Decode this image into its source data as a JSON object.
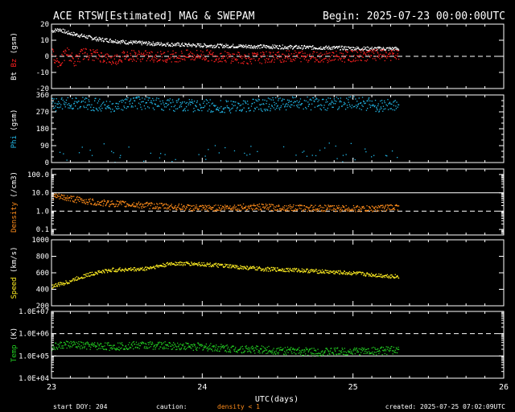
{
  "title": "ACE RTSW[Estimated] MAG & SWEPAM",
  "begin": "Begin: 2025-07-23 00:00:00UTC",
  "xlabel": "UTC(days)",
  "footer": {
    "start": "start DOY: 204",
    "caution": "caution:",
    "density_note": "density < 1",
    "created": "created: 2025-07-25 07:02:09UTC"
  },
  "colors": {
    "bt": "#ffffff",
    "bz": "#ff2020",
    "phi": "#22b8e8",
    "density": "#ff8c1a",
    "speed": "#ffee22",
    "temp": "#22cc22",
    "axes": "#ffffff"
  },
  "chart_data": [
    {
      "type": "scatter",
      "id": "mag",
      "ylabel_parts": [
        {
          "text": "Bt",
          "color": "#ffffff"
        },
        {
          "text": " ",
          "color": "#ffffff"
        },
        {
          "text": "Bz",
          "color": "#ff2020"
        },
        {
          "text": " (gsm)",
          "color": "#ffffff"
        }
      ],
      "ylim": [
        -20,
        20
      ],
      "yticks": [
        -20,
        -10,
        0,
        10,
        20
      ],
      "ylabels": [
        "-20",
        "-10",
        "0",
        "10",
        "20"
      ],
      "ref_lines": [
        {
          "y": 0,
          "style": "dash"
        }
      ],
      "xlim": [
        23,
        26
      ],
      "series": [
        {
          "name": "Bt",
          "color": "#ffffff",
          "x": [
            23.0,
            23.05,
            23.1,
            23.15,
            23.2,
            23.3,
            23.4,
            23.5,
            23.7,
            24.0,
            24.3,
            24.6,
            24.9,
            25.1,
            25.3
          ],
          "y": [
            16,
            17,
            15,
            14,
            13,
            11,
            10,
            9,
            8,
            7,
            6.5,
            6,
            5.5,
            5,
            5
          ]
        },
        {
          "name": "Bz",
          "color": "#ff2020",
          "x": [
            23.0,
            23.05,
            23.1,
            23.15,
            23.2,
            23.3,
            23.4,
            23.5,
            23.7,
            24.0,
            24.3,
            24.6,
            24.9,
            25.1,
            25.3
          ],
          "y": [
            2,
            -4,
            3,
            -3,
            2,
            1,
            -2,
            1,
            0,
            1,
            -1,
            0.5,
            0,
            1,
            1
          ]
        }
      ]
    },
    {
      "type": "scatter",
      "id": "phi",
      "ylabel_parts": [
        {
          "text": "Phi",
          "color": "#22b8e8"
        },
        {
          "text": " (gsm)",
          "color": "#ffffff"
        }
      ],
      "ylim": [
        0,
        360
      ],
      "yticks": [
        0,
        90,
        180,
        270,
        360
      ],
      "ylabels": [
        "0",
        "90",
        "180",
        "270",
        "360"
      ],
      "minor": [
        30,
        60,
        120,
        150,
        210,
        240,
        300,
        330
      ],
      "ref_lines": [],
      "xlim": [
        23,
        26
      ],
      "series": [
        {
          "name": "Phi",
          "color": "#22b8e8",
          "x": [
            23.0,
            23.2,
            23.4,
            23.5,
            23.6,
            23.8,
            24.0,
            24.2,
            24.4,
            24.6,
            24.8,
            25.0,
            25.2,
            25.3
          ],
          "y": [
            310,
            320,
            300,
            315,
            320,
            310,
            305,
            300,
            310,
            320,
            315,
            320,
            305,
            315
          ]
        }
      ]
    },
    {
      "type": "scatter",
      "id": "density",
      "ylabel_parts": [
        {
          "text": "Density",
          "color": "#ff8c1a"
        },
        {
          "text": " (/cm3)",
          "color": "#ffffff"
        }
      ],
      "ylim": [
        0.05,
        200
      ],
      "scale": "log",
      "yticks": [
        0.1,
        1.0,
        10.0,
        100.0
      ],
      "ylabels": [
        "0.1",
        "1.0",
        "10.0",
        "100.0"
      ],
      "ref_lines": [
        {
          "y": 10,
          "style": "solid"
        },
        {
          "y": 1,
          "style": "dash"
        }
      ],
      "xlim": [
        23,
        26
      ],
      "series": [
        {
          "name": "Density",
          "color": "#ff8c1a",
          "x": [
            23.0,
            23.1,
            23.2,
            23.3,
            23.5,
            23.7,
            24.0,
            24.3,
            24.6,
            24.9,
            25.1,
            25.3
          ],
          "y": [
            7,
            5.5,
            4,
            3,
            2.5,
            2,
            1.5,
            1.8,
            1.6,
            1.5,
            1.4,
            1.8
          ]
        }
      ]
    },
    {
      "type": "scatter",
      "id": "speed",
      "ylabel_parts": [
        {
          "text": "Speed",
          "color": "#ffee22"
        },
        {
          "text": " (km/s)",
          "color": "#ffffff"
        }
      ],
      "ylim": [
        200,
        1000
      ],
      "yticks": [
        200,
        400,
        600,
        800,
        1000
      ],
      "ylabels": [
        "200",
        "400",
        "600",
        "800",
        "1000"
      ],
      "ref_lines": [],
      "xlim": [
        23,
        26
      ],
      "series": [
        {
          "name": "Speed",
          "color": "#ffee22",
          "x": [
            23.0,
            23.1,
            23.2,
            23.3,
            23.4,
            23.6,
            23.75,
            23.8,
            24.0,
            24.2,
            24.4,
            24.6,
            24.8,
            25.0,
            25.2,
            25.3
          ],
          "y": [
            440,
            490,
            560,
            610,
            640,
            650,
            700,
            720,
            710,
            680,
            650,
            640,
            620,
            600,
            570,
            560
          ]
        }
      ]
    },
    {
      "type": "scatter",
      "id": "temp",
      "ylabel_parts": [
        {
          "text": "Temp",
          "color": "#22cc22"
        },
        {
          "text": " (K)",
          "color": "#ffffff"
        }
      ],
      "ylim": [
        10000,
        10000000
      ],
      "scale": "log",
      "yticks": [
        10000,
        100000,
        1000000,
        10000000
      ],
      "ylabels": [
        "1.0E+04",
        "1.0E+05",
        "1.0E+06",
        "1.0E+07"
      ],
      "ref_lines": [
        {
          "y": 1000000,
          "style": "dash"
        },
        {
          "y": 100000,
          "style": "solid"
        }
      ],
      "xlim": [
        23,
        26
      ],
      "series": [
        {
          "name": "Temp",
          "color": "#22cc22",
          "x": [
            23.0,
            23.1,
            23.2,
            23.4,
            23.6,
            23.8,
            24.0,
            24.2,
            24.4,
            24.6,
            24.8,
            25.0,
            25.2,
            25.3
          ],
          "y": [
            250000,
            350000,
            300000,
            280000,
            320000,
            300000,
            270000,
            220000,
            200000,
            170000,
            160000,
            170000,
            180000,
            200000
          ]
        }
      ]
    }
  ],
  "x_axis": {
    "ticks": [
      23,
      24,
      25,
      26
    ],
    "labels": [
      "23",
      "24",
      "25",
      "26"
    ],
    "minor_step_hours": 3
  }
}
